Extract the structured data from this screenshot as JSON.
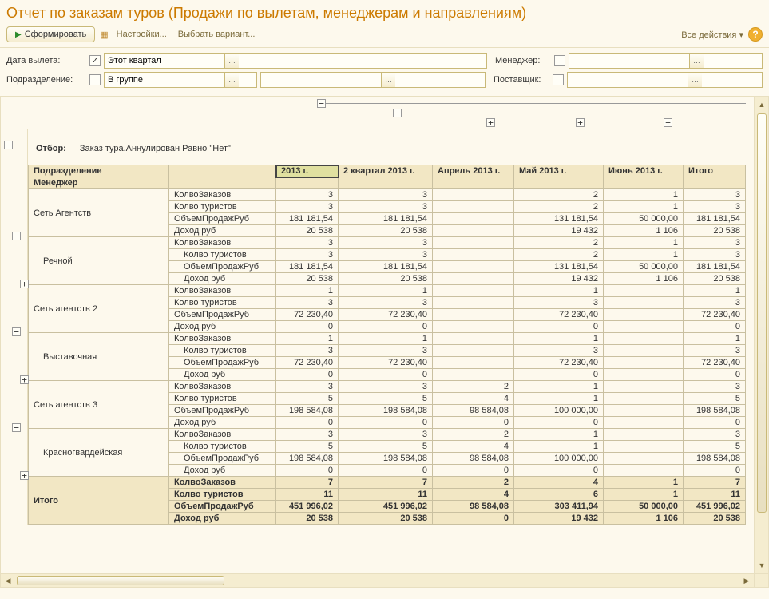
{
  "title": "Отчет по заказам туров (Продажи по вылетам, менеджерам и направлениям)",
  "toolbar": {
    "generate": "Сформировать",
    "settings": "Настройки...",
    "select_variant": "Выбрать вариант...",
    "all_actions": "Все действия"
  },
  "filters": {
    "date_label": "Дата вылета:",
    "date_value": "Этот квартал",
    "division_label": "Подразделение:",
    "division_value": "В группе",
    "manager_label": "Менеджер:",
    "supplier_label": "Поставщик:"
  },
  "report": {
    "filter_caption": "Отбор:",
    "filter_text": "Заказ тура.Аннулирован Равно \"Нет\"",
    "headers": {
      "division": "Подразделение",
      "manager": "Менеджер",
      "c1": "2013 г.",
      "c2": "2 квартал 2013 г.",
      "c3": "Апрель 2013 г.",
      "c4": "Май 2013 г.",
      "c5": "Июнь 2013 г.",
      "c6": "Итого"
    },
    "metrics": {
      "orders": "КолвоЗаказов",
      "tourists": "Колво туристов",
      "sales": "ОбъемПродажРуб",
      "income": "Доход руб"
    },
    "groups": [
      {
        "name": "Сеть Агентств",
        "rows": {
          "orders": [
            "3",
            "3",
            "",
            "2",
            "1",
            "3"
          ],
          "tourists": [
            "3",
            "3",
            "",
            "2",
            "1",
            "3"
          ],
          "sales": [
            "181 181,54",
            "181 181,54",
            "",
            "131 181,54",
            "50 000,00",
            "181 181,54"
          ],
          "income": [
            "20 538",
            "20 538",
            "",
            "19 432",
            "1 106",
            "20 538"
          ]
        },
        "sub": {
          "name": "Речной",
          "rows": {
            "orders": [
              "3",
              "3",
              "",
              "2",
              "1",
              "3"
            ],
            "tourists": [
              "3",
              "3",
              "",
              "2",
              "1",
              "3"
            ],
            "sales": [
              "181 181,54",
              "181 181,54",
              "",
              "131 181,54",
              "50 000,00",
              "181 181,54"
            ],
            "income": [
              "20 538",
              "20 538",
              "",
              "19 432",
              "1 106",
              "20 538"
            ]
          }
        }
      },
      {
        "name": "Сеть агентств 2",
        "rows": {
          "orders": [
            "1",
            "1",
            "",
            "1",
            "",
            "1"
          ],
          "tourists": [
            "3",
            "3",
            "",
            "3",
            "",
            "3"
          ],
          "sales": [
            "72 230,40",
            "72 230,40",
            "",
            "72 230,40",
            "",
            "72 230,40"
          ],
          "income": [
            "0",
            "0",
            "",
            "0",
            "",
            "0"
          ]
        },
        "sub": {
          "name": "Выставочная",
          "rows": {
            "orders": [
              "1",
              "1",
              "",
              "1",
              "",
              "1"
            ],
            "tourists": [
              "3",
              "3",
              "",
              "3",
              "",
              "3"
            ],
            "sales": [
              "72 230,40",
              "72 230,40",
              "",
              "72 230,40",
              "",
              "72 230,40"
            ],
            "income": [
              "0",
              "0",
              "",
              "0",
              "",
              "0"
            ]
          }
        }
      },
      {
        "name": "Сеть агентств 3",
        "rows": {
          "orders": [
            "3",
            "3",
            "2",
            "1",
            "",
            "3"
          ],
          "tourists": [
            "5",
            "5",
            "4",
            "1",
            "",
            "5"
          ],
          "sales": [
            "198 584,08",
            "198 584,08",
            "98 584,08",
            "100 000,00",
            "",
            "198 584,08"
          ],
          "income": [
            "0",
            "0",
            "0",
            "0",
            "",
            "0"
          ]
        },
        "sub": {
          "name": "Красногвардейская",
          "rows": {
            "orders": [
              "3",
              "3",
              "2",
              "1",
              "",
              "3"
            ],
            "tourists": [
              "5",
              "5",
              "4",
              "1",
              "",
              "5"
            ],
            "sales": [
              "198 584,08",
              "198 584,08",
              "98 584,08",
              "100 000,00",
              "",
              "198 584,08"
            ],
            "income": [
              "0",
              "0",
              "0",
              "0",
              "",
              "0"
            ]
          }
        }
      }
    ],
    "totals": {
      "name": "Итого",
      "rows": {
        "orders": [
          "7",
          "7",
          "2",
          "4",
          "1",
          "7"
        ],
        "tourists": [
          "11",
          "11",
          "4",
          "6",
          "1",
          "11"
        ],
        "sales": [
          "451 996,02",
          "451 996,02",
          "98 584,08",
          "303 411,94",
          "50 000,00",
          "451 996,02"
        ],
        "income": [
          "20 538",
          "20 538",
          "0",
          "19 432",
          "1 106",
          "20 538"
        ]
      }
    }
  }
}
